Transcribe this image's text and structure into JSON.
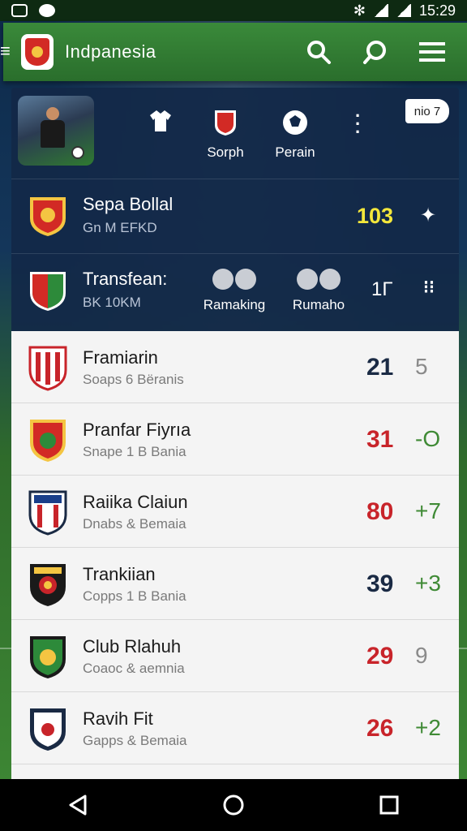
{
  "status_bar": {
    "time": "15:29"
  },
  "app_bar": {
    "title": "Indpanesia"
  },
  "hero": {
    "actions": [
      {
        "label": "",
        "icon": "jersey-icon"
      },
      {
        "label": "Sorph",
        "icon": "club-badge-icon"
      },
      {
        "label": "Pеrain",
        "icon": "ball-icon"
      }
    ],
    "chip_label": "nio 7"
  },
  "featured": {
    "title": "Sepa Bollal",
    "subtitle": "Gn M EFKD",
    "score": "103"
  },
  "transfer": {
    "title": "Transfean:",
    "subtitle": "BK 10KM",
    "buttons": [
      {
        "label": "Ramaking"
      },
      {
        "label": "Rumaho"
      }
    ],
    "number": "1Г"
  },
  "list": [
    {
      "title": "Framiarin",
      "subtitle": "Soaps 6 Bёranis",
      "score": "21",
      "delta": "5",
      "score_color": "#1a2a44",
      "delta_color": "#8a8a8a"
    },
    {
      "title": "Pranfar Fiyrıa",
      "subtitle": "Snape 1 B Bania",
      "score": "31",
      "delta": "-O",
      "score_color": "#c8242a",
      "delta_color": "#3f8a35"
    },
    {
      "title": "Raiika Claiun",
      "subtitle": "Dnabs & Bemaia",
      "score": "80",
      "delta": "+7",
      "score_color": "#c8242a",
      "delta_color": "#3f8a35"
    },
    {
      "title": "Trankiian",
      "subtitle": "Copps 1 B Bania",
      "score": "39",
      "delta": "+3",
      "score_color": "#1a2a44",
      "delta_color": "#3f8a35"
    },
    {
      "title": "Club Rlahuh",
      "subtitle": "Coaoc & aemnia",
      "score": "29",
      "delta": "9",
      "score_color": "#c8242a",
      "delta_color": "#8a8a8a"
    },
    {
      "title": "Ravih Fit",
      "subtitle": "Gapps & Bemaia",
      "score": "26",
      "delta": "+2",
      "score_color": "#c8242a",
      "delta_color": "#3f8a35"
    }
  ],
  "colors": {
    "app_bar": "#2f7a30",
    "dark_card": "#122848",
    "highlight": "#f4e73b"
  }
}
